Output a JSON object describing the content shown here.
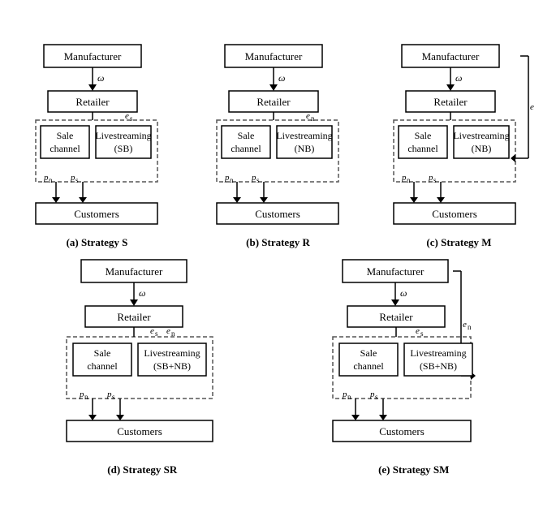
{
  "strategies": [
    {
      "id": "a",
      "label": "(a) Strategy S",
      "caption": "(a) Strategy S",
      "manufacturer": "Manufacturer",
      "retailer": "Retailer",
      "channel1": "Sale\nchannel",
      "channel2": "Livestreaming\n(SB)",
      "customers": "Customers",
      "omega": "ω",
      "es_label": "e_s",
      "pn_label": "p_n",
      "ps_label": "p_s"
    },
    {
      "id": "b",
      "label": "(b) Strategy R",
      "caption": "(b) Strategy R",
      "manufacturer": "Manufacturer",
      "retailer": "Retailer",
      "channel1": "Sale\nchannel",
      "channel2": "Livestreaming\n(NB)",
      "customers": "Customers",
      "omega": "ω",
      "en_label": "e_n",
      "pn_label": "p_n",
      "ps_label": "p_s"
    },
    {
      "id": "c",
      "label": "(c) Strategy M",
      "caption": "(c) Strategy M",
      "manufacturer": "Manufacturer",
      "retailer": "Retailer",
      "channel1": "Sale\nchannel",
      "channel2": "Livestreaming\n(NB)",
      "customers": "Customers",
      "omega": "ω",
      "en_label": "e_n",
      "pn_label": "p_n",
      "ps_label": "p_s"
    },
    {
      "id": "d",
      "label": "(d) Strategy SR",
      "caption": "(d) Strategy SR",
      "manufacturer": "Manufacturer",
      "retailer": "Retailer",
      "channel1": "Sale\nchannel",
      "channel2": "Livestreaming\n(SB+NB)",
      "customers": "Customers",
      "omega": "ω",
      "es_label": "e_s",
      "en_label": "e_n",
      "pn_label": "p_n",
      "ps_label": "p_s"
    },
    {
      "id": "e",
      "label": "(e) Strategy SM",
      "caption": "(e) Strategy SM",
      "manufacturer": "Manufacturer",
      "retailer": "Retailer",
      "channel1": "Sale\nchannel",
      "channel2": "Livestreaming\n(SB+NB)",
      "customers": "Customers",
      "omega": "ω",
      "es_label": "e_s",
      "en_label": "e_n",
      "pn_label": "p_n",
      "ps_label": "p_s"
    }
  ]
}
